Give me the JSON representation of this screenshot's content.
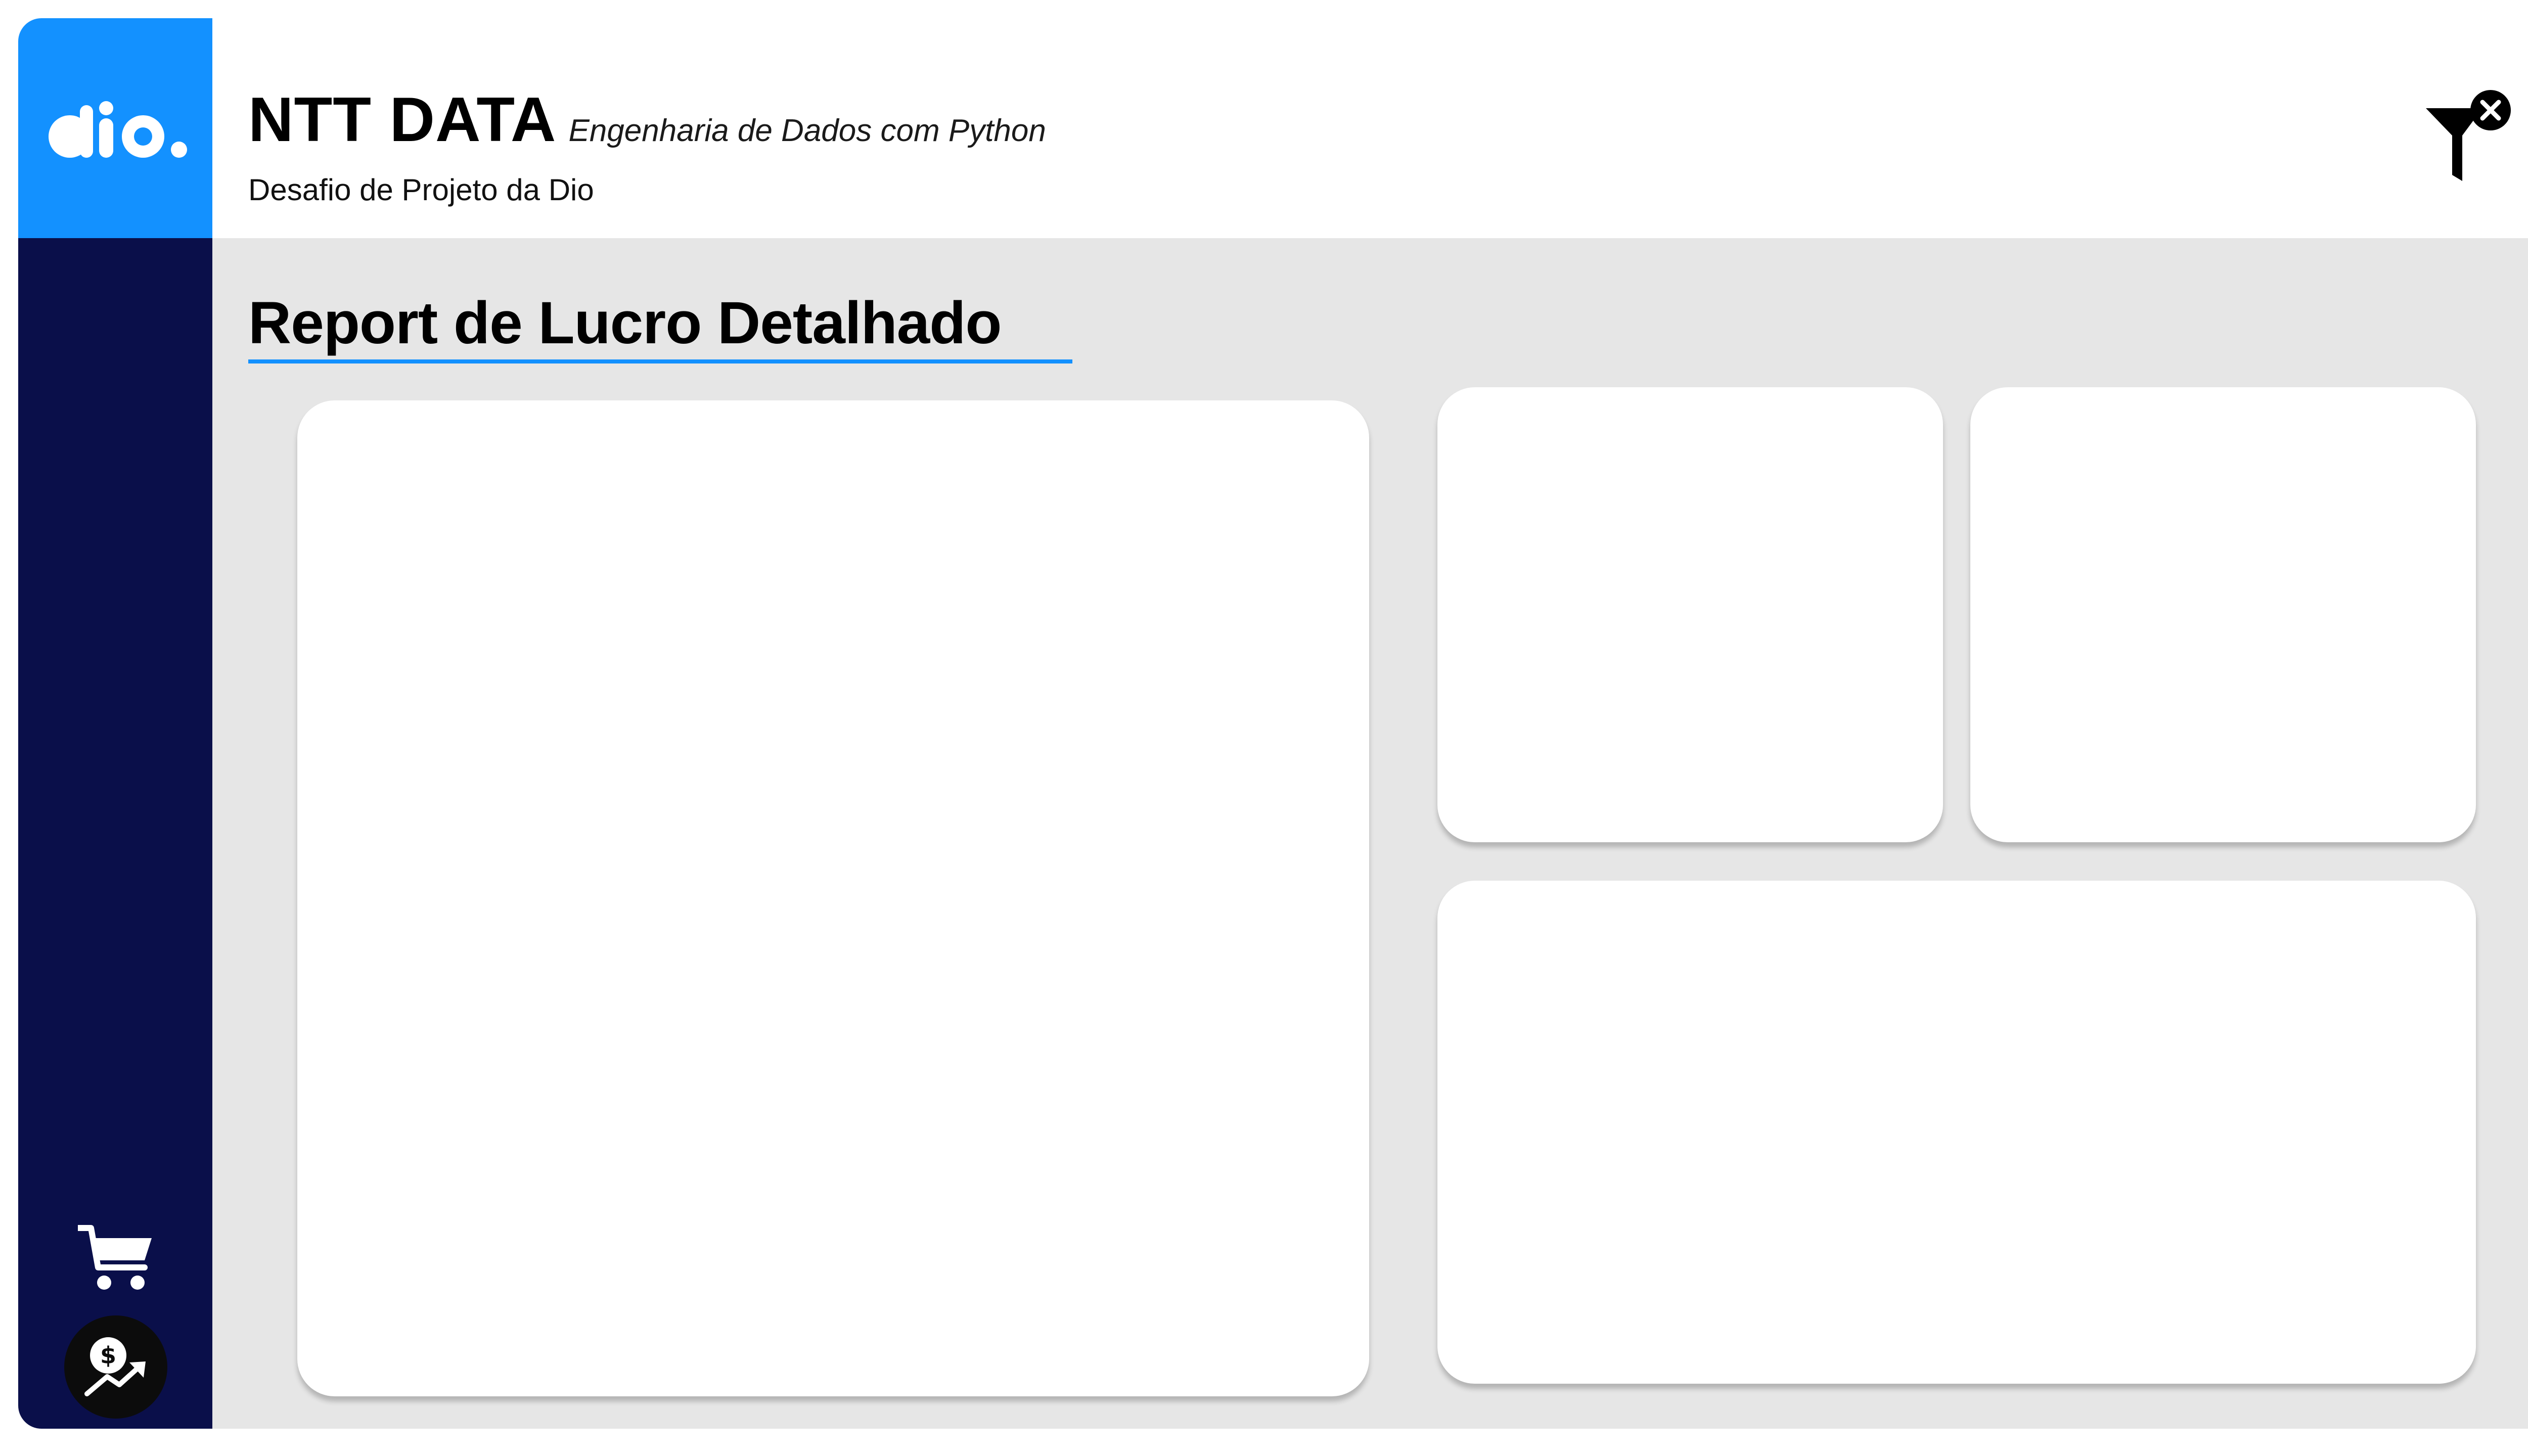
{
  "header": {
    "logo_icon": "dio-logo-icon",
    "title": "NTT DATA",
    "title_suffix": "Engenharia de Dados com Python",
    "subtitle": "Desafio de Projeto da Dio",
    "clear_filters_icon": "filter-clear-icon"
  },
  "sidebar": {
    "items": [
      {
        "icon": "shopping-cart-icon"
      },
      {
        "icon": "profit-icon"
      }
    ]
  },
  "main": {
    "page_title": "Report de Lucro Detalhado"
  },
  "colors": {
    "accent_blue": "#1391ff",
    "sidebar_navy": "#0a0f4a",
    "canvas_gray": "#e6e6e6",
    "card_white": "#ffffff"
  }
}
